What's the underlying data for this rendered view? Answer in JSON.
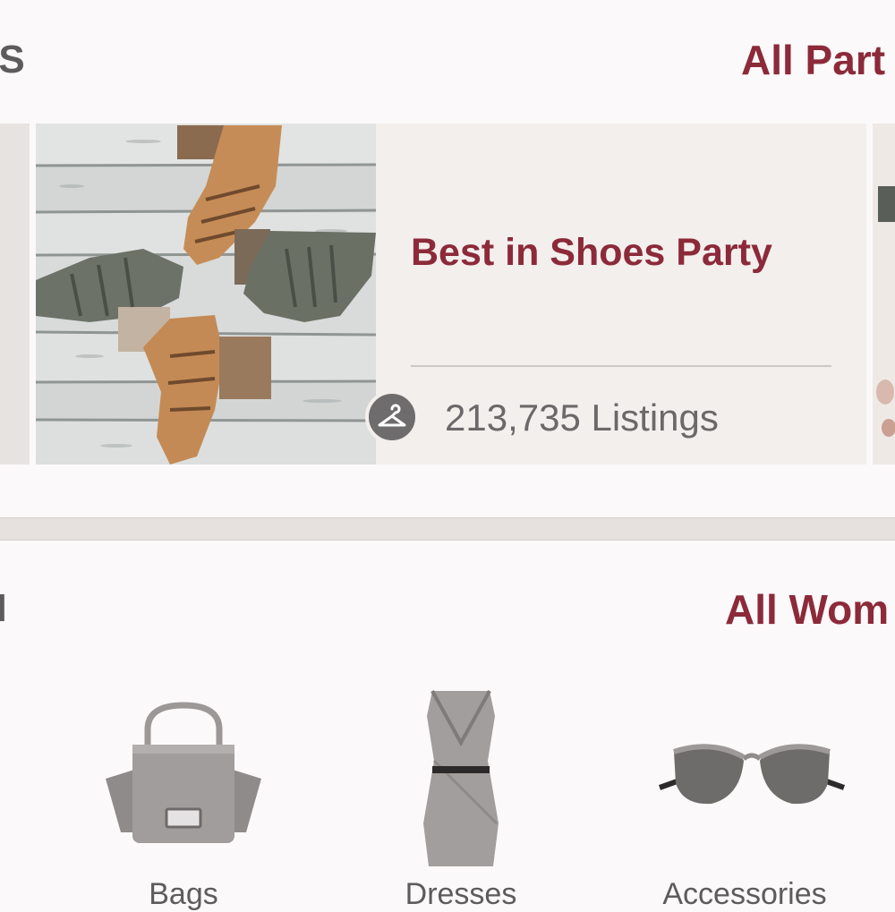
{
  "colors": {
    "brand": "#8c2a3a",
    "text_gray": "#5d5b5c",
    "card_bg": "#f3efed",
    "divider_bg": "#e6e1de"
  },
  "parties_section": {
    "title_partial": "ES",
    "see_all_link": "All Part"
  },
  "party_card": {
    "title": "Best in Shoes Party",
    "listings": "213,735 Listings",
    "icon": "hanger-icon",
    "image": "shoes-photo"
  },
  "shop_section": {
    "title_partial": "N",
    "see_all_link": "All Wom"
  },
  "categories": [
    {
      "label": "Bags",
      "icon": "bag-icon"
    },
    {
      "label": "Dresses",
      "icon": "dress-icon"
    },
    {
      "label": "Accessories",
      "icon": "sunglasses-icon"
    }
  ]
}
